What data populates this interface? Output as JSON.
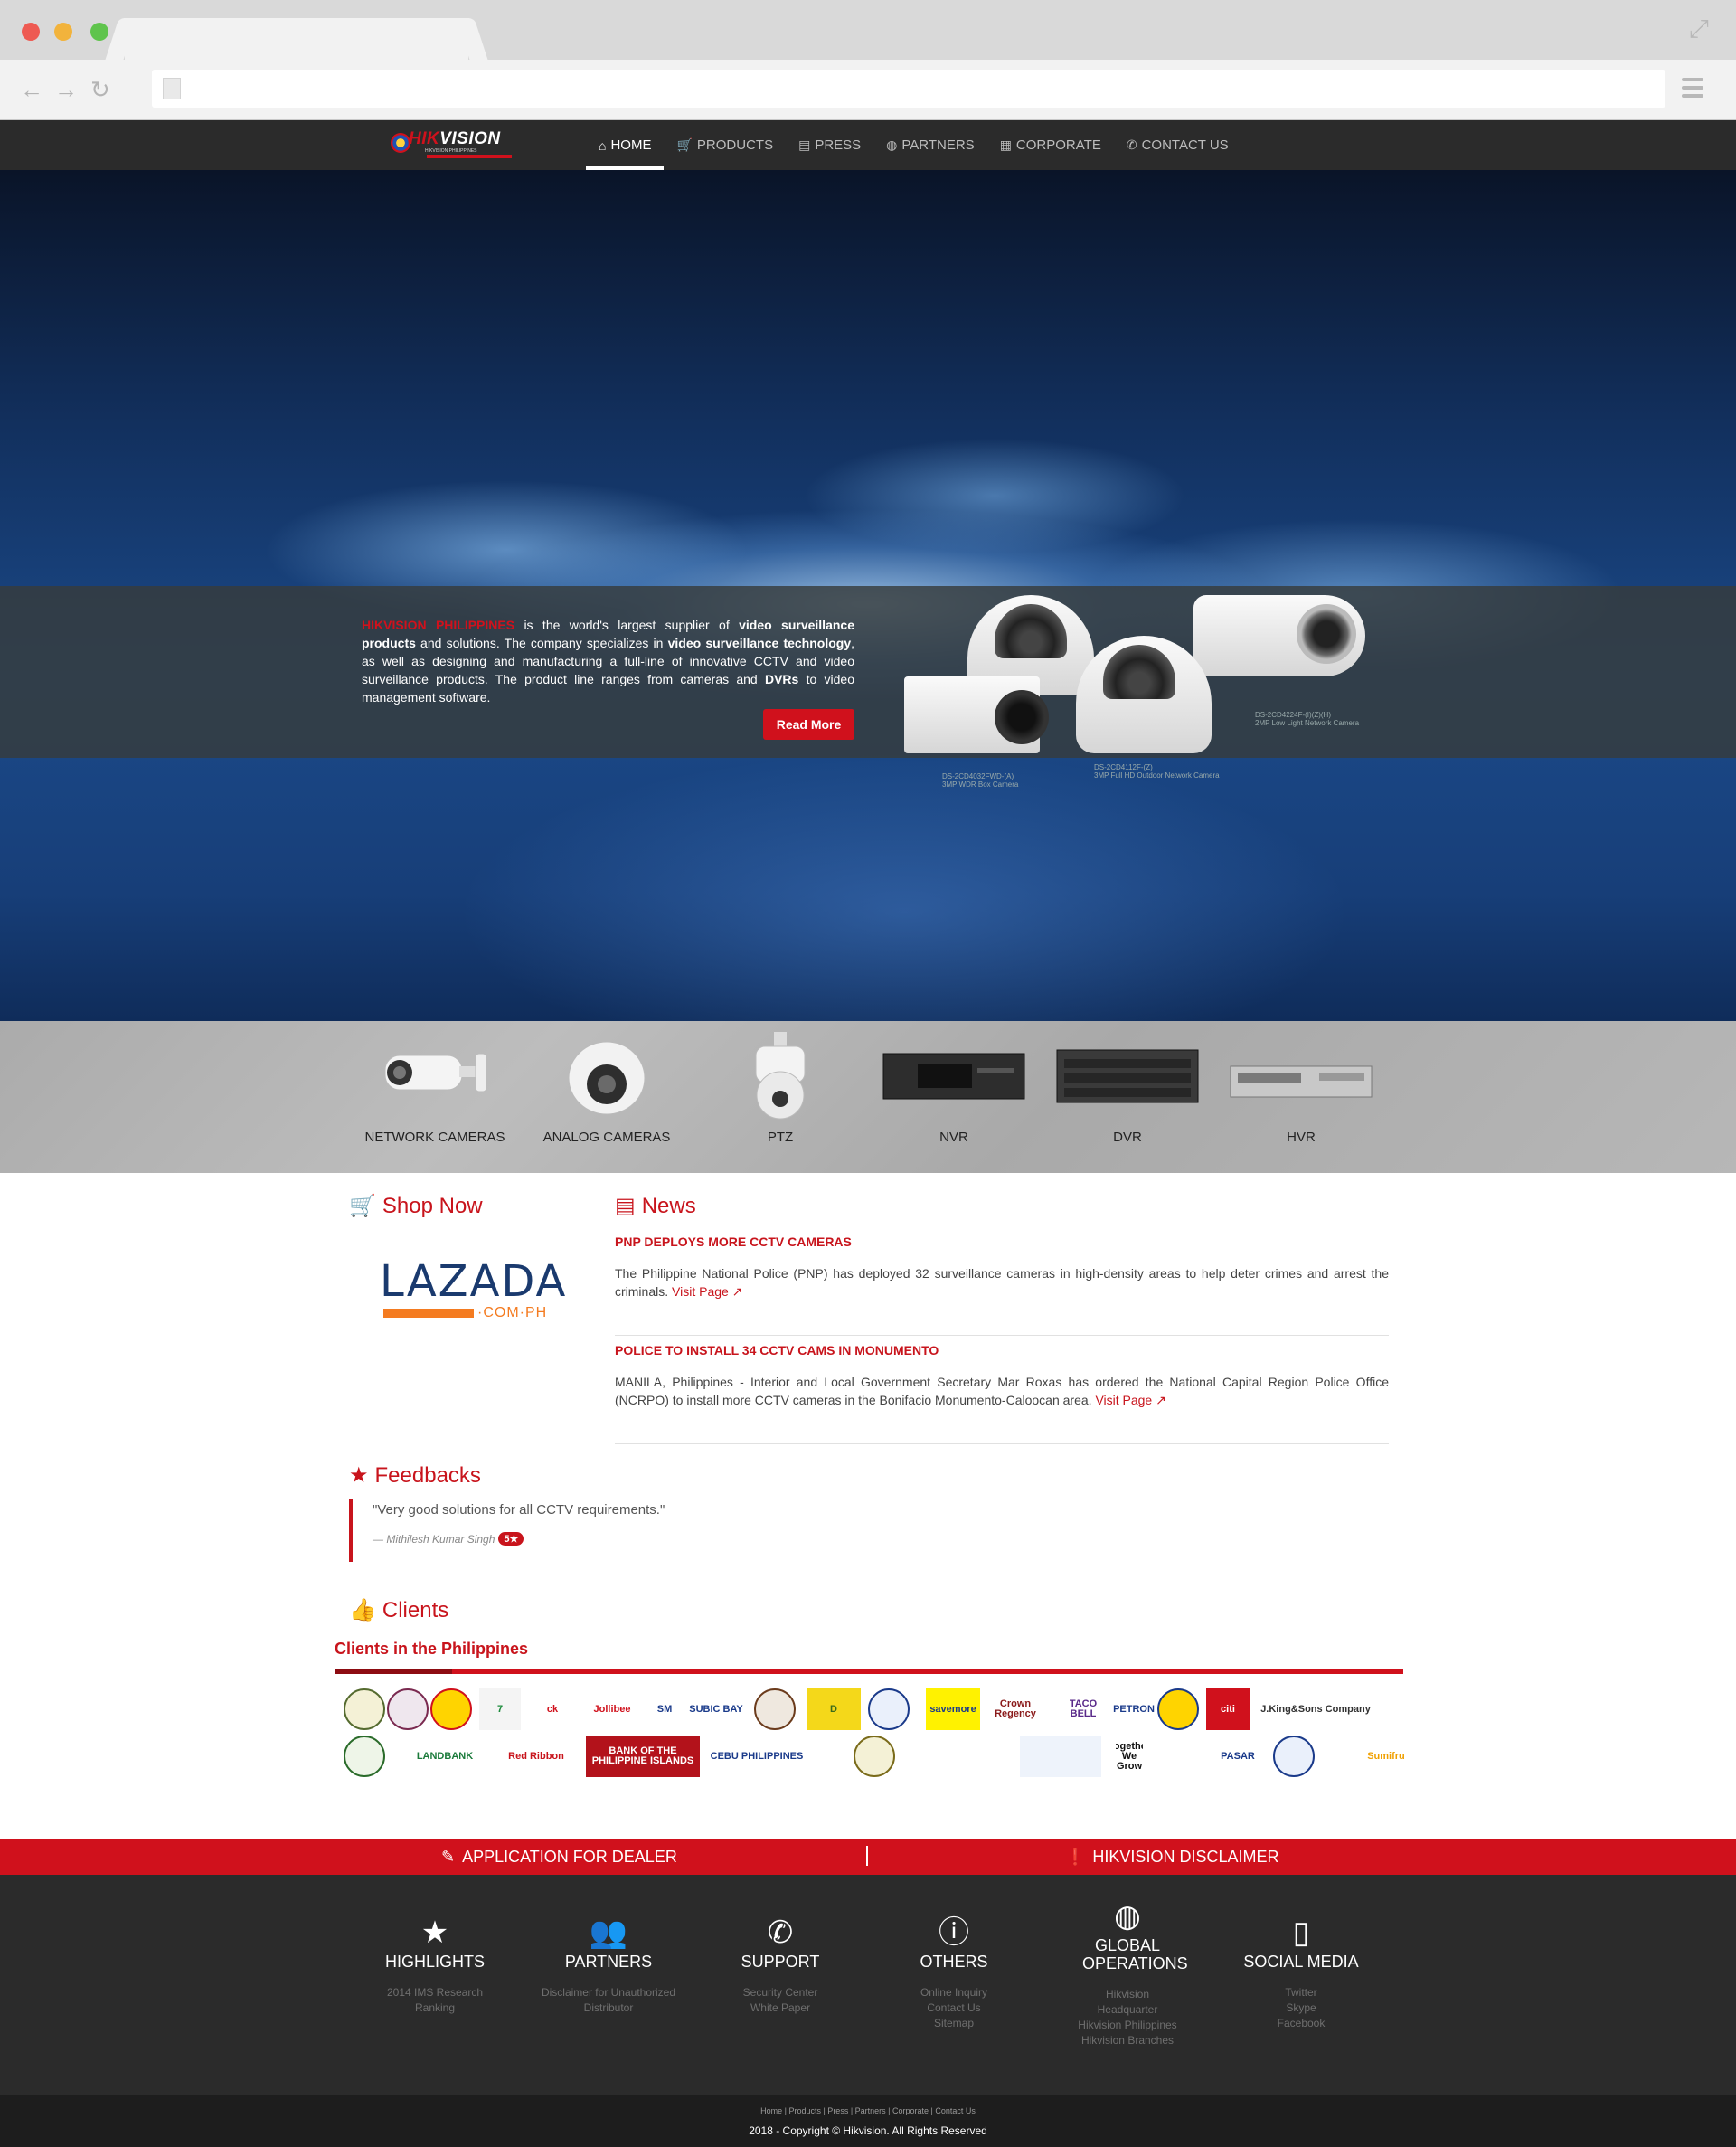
{
  "browser": {
    "nav": {
      "back": "←",
      "forward": "→",
      "reload": "↻"
    }
  },
  "header": {
    "logo": {
      "brand_hik": "HIK",
      "brand_vision": "VISION",
      "sub": "HIKVISION PHILIPPINES"
    },
    "menu": [
      {
        "label": "HOME",
        "icon": "home-icon",
        "glyph": "⌂"
      },
      {
        "label": "PRODUCTS",
        "icon": "cart-icon",
        "glyph": "🛒"
      },
      {
        "label": "PRESS",
        "icon": "newspaper-icon",
        "glyph": "▤"
      },
      {
        "label": "PARTNERS",
        "icon": "globe-icon",
        "glyph": "◍"
      },
      {
        "label": "CORPORATE",
        "icon": "briefcase-icon",
        "glyph": "▦"
      },
      {
        "label": "CONTACT US",
        "icon": "phone-icon",
        "glyph": "✆"
      }
    ]
  },
  "hero": {
    "brand": "HIKVISION PHILIPPINES",
    "t1": " is the world's largest supplier of ",
    "b1": "video surveillance products",
    "t2": " and solutions. The company specializes in ",
    "b2": "video surveillance technology",
    "t3": ", as well as designing and manufacturing a full-line of innovative CCTV and video surveillance products. The product line ranges from cameras and ",
    "b3": "DVRs",
    "t4": " to video management software.",
    "read_more": "Read More",
    "cam_labels": [
      "DS-2CD4032FWD-(A)",
      "3MP WDR Box Camera",
      "DS-2CD4112F-(Z)",
      "3MP Full HD Outdoor Network Camera",
      "DS-2CD4224F-(I)(Z)(H)",
      "2MP Low Light Network Camera"
    ]
  },
  "products": [
    "NETWORK CAMERAS",
    "ANALOG CAMERAS",
    "PTZ",
    "NVR",
    "DVR",
    "HVR"
  ],
  "shop": {
    "title": "Shop Now",
    "lazada_word": "LAZADA",
    "lazada_sub": "·COM·PH"
  },
  "news": {
    "title": "News",
    "items": [
      {
        "heading": "PNP DEPLOYS MORE CCTV CAMERAS",
        "body": "The Philippine National Police (PNP) has deployed 32 surveillance cameras in high-density areas to help deter crimes and arrest the criminals. ",
        "link": "Visit Page ↗"
      },
      {
        "heading": "POLICE TO INSTALL 34 CCTV CAMS IN MONUMENTO",
        "body": "MANILA, Philippines - Interior and Local Government Secretary Mar Roxas has ordered the National Capital Region Police Office (NCRPO) to install more CCTV cameras in the Bonifacio Monumento-Caloocan area. ",
        "link": "Visit Page ↗"
      }
    ]
  },
  "feedbacks": {
    "title": "Feedbacks",
    "quote": "\"Very good solutions for all CCTV requirements.\"",
    "author": "— Mithilesh Kumar Singh",
    "rating": "5★"
  },
  "clients": {
    "title": "Clients",
    "subtitle": "Clients in the Philippines",
    "row1": [
      "",
      "",
      "",
      "7",
      "ck",
      "Jollibee",
      "SM",
      "SUBIC BAY",
      "",
      "D",
      "",
      "savemore",
      "Crown Regency",
      "TACO BELL",
      "PETRON",
      "",
      "citi",
      "J.King&Sons Company"
    ],
    "row2": [
      "",
      "LANDBANK",
      "Red Ribbon",
      "BANK OF THE PHILIPPINE ISLANDS",
      "CEBU PHILIPPINES",
      "",
      "",
      "",
      "Together We Grow",
      "",
      "PASAR",
      "",
      "Sumifru"
    ]
  },
  "cta": {
    "dealer": "APPLICATION FOR DEALER",
    "disclaimer": "HIKVISION DISCLAIMER",
    "separator": "|"
  },
  "footer": {
    "cols": [
      {
        "title": "HIGHLIGHTS",
        "icon": "star-icon",
        "glyph": "★",
        "links": [
          "2014 IMS Research",
          "Ranking"
        ]
      },
      {
        "title": "PARTNERS",
        "icon": "users-icon",
        "glyph": "👥",
        "links": [
          "Disclaimer for Unauthorized",
          "Distributor"
        ]
      },
      {
        "title": "SUPPORT",
        "icon": "phone-icon",
        "glyph": "✆",
        "links": [
          "Security Center",
          "White Paper"
        ]
      },
      {
        "title": "OTHERS",
        "icon": "info-icon",
        "glyph": "ⓘ",
        "links": [
          "Online Inquiry",
          "Contact Us",
          "Sitemap"
        ]
      },
      {
        "title": "GLOBAL OPERATIONS",
        "icon": "globe-icon",
        "glyph": "◍",
        "links": [
          "Hikvision",
          "Headquarter",
          "Hikvision Philippines",
          "Hikvision Branches"
        ]
      },
      {
        "title": "SOCIAL MEDIA",
        "icon": "social-icon",
        "glyph": "▯",
        "links": [
          "Twitter",
          "Skype",
          "Facebook"
        ]
      }
    ],
    "bottom_links": "Home | Products | Press | Partners | Corporate | Contact Us",
    "copyright": "2018 - Copyright © Hikvision. All Rights Reserved"
  }
}
